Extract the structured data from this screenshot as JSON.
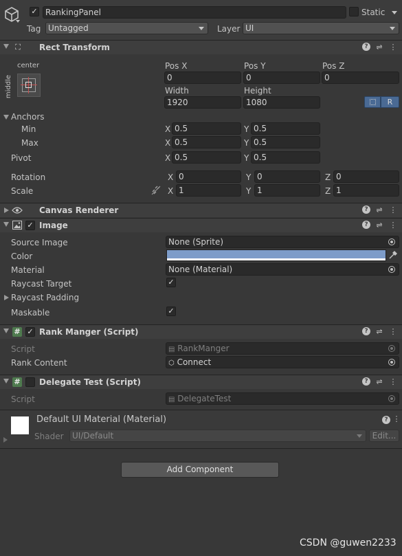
{
  "gameobject": {
    "name": "RankingPanel",
    "static_label": "Static",
    "tag_label": "Tag",
    "tag_value": "Untagged",
    "layer_label": "Layer",
    "layer_value": "UI"
  },
  "rect_transform": {
    "title": "Rect Transform",
    "anchor_h": "center",
    "anchor_v": "middle",
    "pos_x_label": "Pos X",
    "pos_y_label": "Pos Y",
    "pos_z_label": "Pos Z",
    "pos_x": "0",
    "pos_y": "0",
    "pos_z": "0",
    "width_label": "Width",
    "height_label": "Height",
    "width": "1920",
    "height": "1080",
    "r_button": "R",
    "anchors_label": "Anchors",
    "min_label": "Min",
    "max_label": "Max",
    "pivot_label": "Pivot",
    "min_x": "0.5",
    "min_y": "0.5",
    "max_x": "0.5",
    "max_y": "0.5",
    "pivot_x": "0.5",
    "pivot_y": "0.5",
    "rotation_label": "Rotation",
    "scale_label": "Scale",
    "rot_x": "0",
    "rot_y": "0",
    "rot_z": "0",
    "scale_x": "1",
    "scale_y": "1",
    "scale_z": "1",
    "x": "X",
    "y": "Y",
    "z": "Z"
  },
  "canvas_renderer": {
    "title": "Canvas Renderer"
  },
  "image": {
    "title": "Image",
    "source_image_label": "Source Image",
    "source_image_value": "None (Sprite)",
    "color_label": "Color",
    "color_value": "#7d9cc9",
    "material_label": "Material",
    "material_value": "None (Material)",
    "raycast_target_label": "Raycast Target",
    "raycast_padding_label": "Raycast Padding",
    "maskable_label": "Maskable"
  },
  "rank_manger": {
    "title": "Rank Manger (Script)",
    "script_label": "Script",
    "script_value": "RankManger",
    "rank_content_label": "Rank Content",
    "rank_content_value": "Connect"
  },
  "delegate_test": {
    "title": "Delegate Test (Script)",
    "script_label": "Script",
    "script_value": "DelegateTest"
  },
  "material_preview": {
    "title": "Default UI Material (Material)",
    "shader_label": "Shader",
    "shader_value": "UI/Default",
    "edit_button": "Edit..."
  },
  "add_component_button": "Add Component",
  "watermark": "CSDN @guwen2233"
}
